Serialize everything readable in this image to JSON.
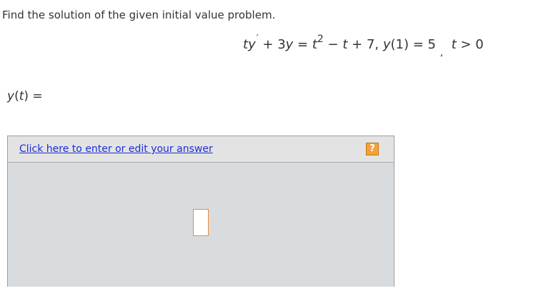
{
  "prompt": "Find the solution of the given initial value problem.",
  "equation": {
    "lhs_t": "t",
    "lhs_y": "y",
    "lhs_prime": "′",
    "lhs_rest": " + 3",
    "lhs_y2": "y",
    "equals": " = ",
    "rhs_t": "t",
    "rhs_exp": "2",
    "rhs_minus": " − ",
    "rhs_t2": "t",
    "rhs_plus": " + 7,   ",
    "ic_y": "y",
    "ic_arg": "(1) = 5",
    "ic_comma": ",",
    "ic_t": "t",
    "ic_cond": " > 0"
  },
  "answer": {
    "y": "y",
    "open": "(",
    "t": "t",
    "close": ") =",
    "edit_link": "Click here to enter or edit your answer",
    "help_label": "?"
  },
  "colors": {
    "link": "#1a2fd6",
    "help_button": "#f2a23a",
    "cursor_border": "#e8893a",
    "answer_area": "#d9dcdf"
  }
}
